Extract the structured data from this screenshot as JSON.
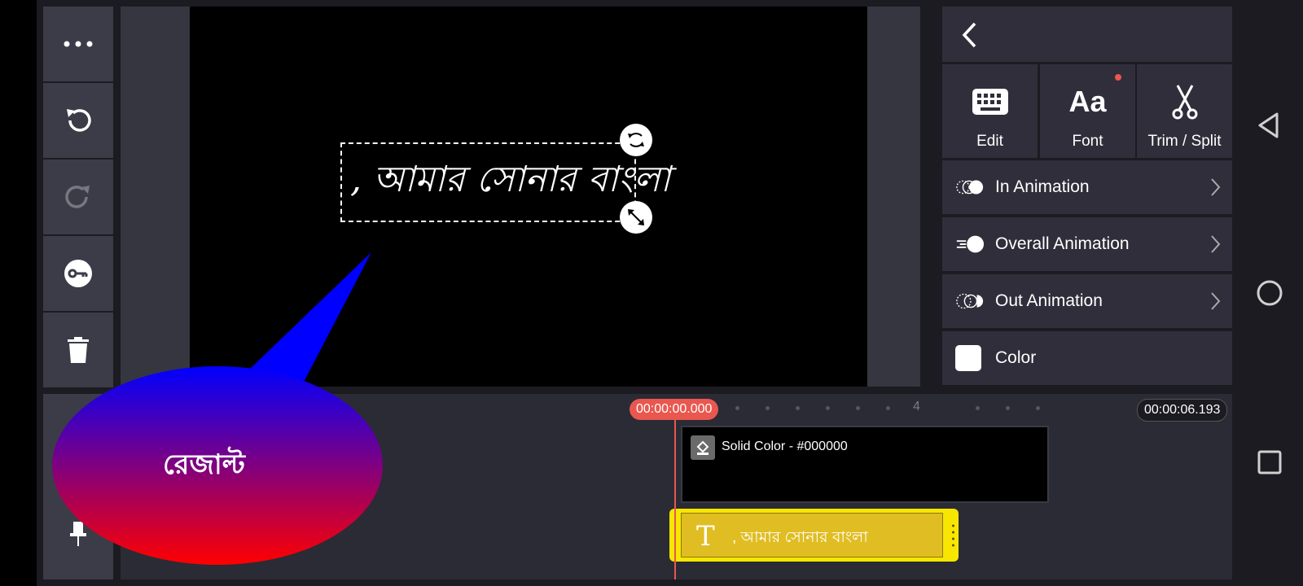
{
  "toolbar": {
    "items": [
      {
        "name": "more-options-button",
        "icon": "more-dots-icon"
      },
      {
        "name": "undo-button",
        "icon": "undo-icon"
      },
      {
        "name": "redo-button",
        "icon": "redo-icon"
      },
      {
        "name": "keyframe-button",
        "icon": "key-icon"
      },
      {
        "name": "delete-button",
        "icon": "trash-icon"
      }
    ]
  },
  "preview": {
    "overlay_text": ", আমার সোনার বাংলা"
  },
  "panel": {
    "back_icon": "chevron-left-icon",
    "tools": [
      {
        "label": "Edit",
        "icon": "keyboard-icon"
      },
      {
        "label": "Font",
        "icon": "font-aa-icon",
        "has_badge": true
      },
      {
        "label": "Trim / Split",
        "icon": "scissors-icon"
      }
    ],
    "rows": [
      {
        "label": "In Animation",
        "icon": "in-animation-icon"
      },
      {
        "label": "Overall Animation",
        "icon": "overall-animation-icon"
      },
      {
        "label": "Out Animation",
        "icon": "out-animation-icon"
      },
      {
        "label": "Color",
        "icon": "color-swatch-icon",
        "swatch": "#FFFFFF"
      }
    ]
  },
  "timeline": {
    "playhead_time": "00:00:00.000",
    "end_time": "00:00:06.193",
    "tick_label": "4",
    "solid_clip_label": "Solid Color - #000000",
    "text_clip_glyph": "T",
    "text_clip_label": ", আমার সোনার বাংলা",
    "pin_icon": "pin-icon"
  },
  "overlay": {
    "bubble_text": "রেজাল্ট"
  },
  "colors": {
    "accent": "#E9574F",
    "text_clip": "#F7E600",
    "bubble_top": "#0000FF",
    "bubble_bottom": "#FF0000"
  }
}
